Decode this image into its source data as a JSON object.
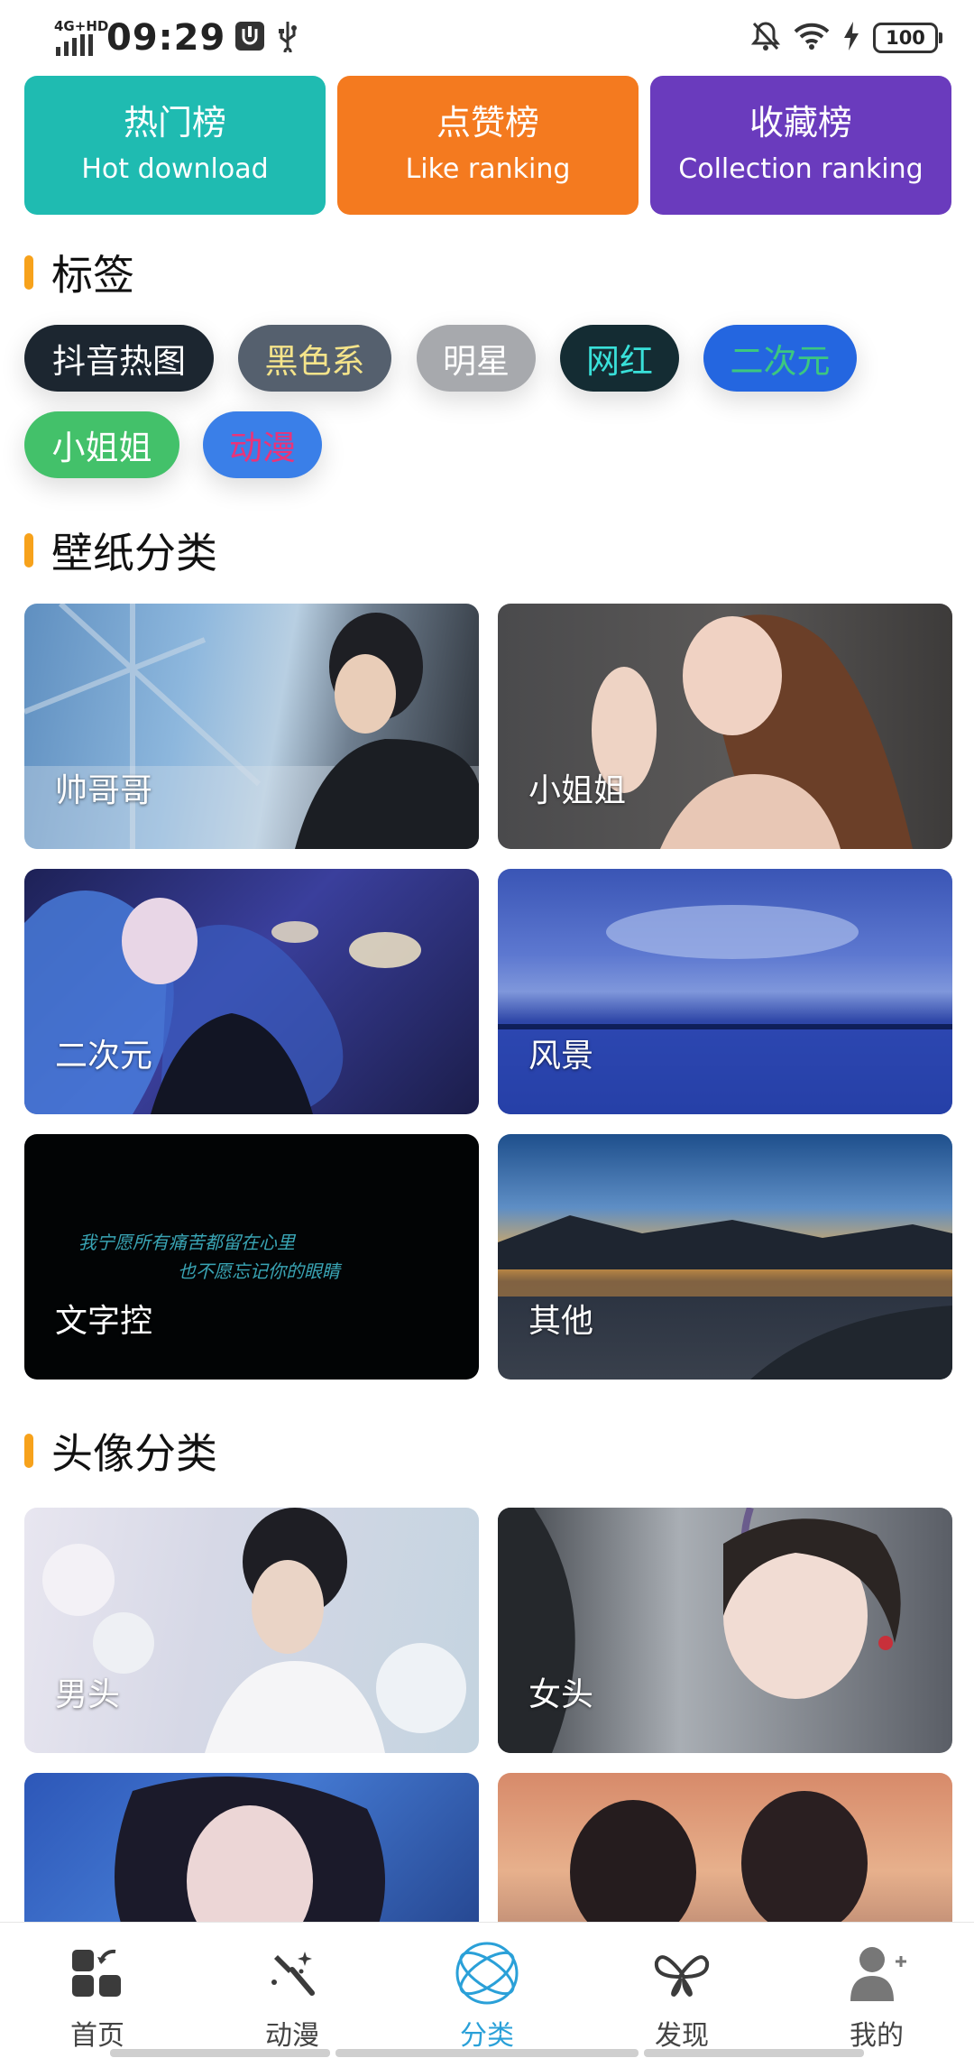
{
  "status_bar": {
    "network": "4G+HD",
    "time": "09:29",
    "battery": "100",
    "icons": [
      "signal-icon",
      "usb-debug-icon",
      "usb-icon",
      "silent-bell-icon",
      "wifi-icon",
      "charging-icon",
      "battery-icon"
    ]
  },
  "rank_cards": [
    {
      "title": "热门榜",
      "subtitle": "Hot download",
      "color": "#1fbbb1"
    },
    {
      "title": "点赞榜",
      "subtitle": "Like ranking",
      "color": "#f47a1f"
    },
    {
      "title": "收藏榜",
      "subtitle": "Collection ranking",
      "color": "#6a3bbd"
    }
  ],
  "tags_section": {
    "title": "标签"
  },
  "tags": [
    {
      "label": "抖音热图",
      "bg": "#1c2630",
      "fg": "#ffffff"
    },
    {
      "label": "黑色系",
      "bg": "#55606e",
      "fg": "#f5e48a"
    },
    {
      "label": "明星",
      "bg": "#a7a9ad",
      "fg": "#ffffff"
    },
    {
      "label": "网红",
      "bg": "#142c33",
      "fg": "#39e0d9"
    },
    {
      "label": "二次元",
      "bg": "#2466e0",
      "fg": "#3cc780"
    },
    {
      "label": "小姐姐",
      "bg": "#43c16a",
      "fg": "#ffffff"
    },
    {
      "label": "动漫",
      "bg": "#3a7fe8",
      "fg": "#e8347a"
    }
  ],
  "wallpaper_section": {
    "title": "壁纸分类"
  },
  "wallpaper_tiles": [
    {
      "label": "帅哥哥"
    },
    {
      "label": "小姐姐"
    },
    {
      "label": "二次元"
    },
    {
      "label": "风景"
    },
    {
      "label": "文字控",
      "art_line1": "我宁愿所有痛苦都留在心里",
      "art_line2": "也不愿忘记你的眼睛"
    },
    {
      "label": "其他"
    }
  ],
  "avatar_section": {
    "title": "头像分类"
  },
  "avatar_tiles": [
    {
      "label": "男头"
    },
    {
      "label": "女头"
    },
    {
      "label": ""
    },
    {
      "label": ""
    }
  ],
  "bottom_nav": [
    {
      "label": "首页",
      "icon": "home-grid-icon",
      "active": false
    },
    {
      "label": "动漫",
      "icon": "magic-wand-icon",
      "active": false
    },
    {
      "label": "分类",
      "icon": "orbit-icon",
      "active": true
    },
    {
      "label": "发现",
      "icon": "butterfly-icon",
      "active": false
    },
    {
      "label": "我的",
      "icon": "user-add-icon",
      "active": false
    }
  ],
  "colors": {
    "accent": "#f7a21b",
    "nav_active": "#2aa0d8"
  }
}
